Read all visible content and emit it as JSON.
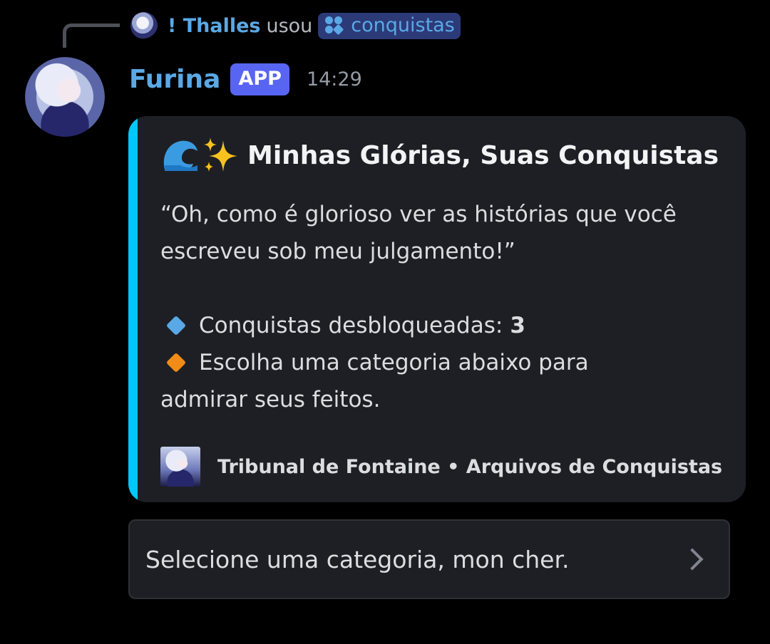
{
  "reply": {
    "user": "! Thalles",
    "action": "usou",
    "command": "conquistas",
    "user_color": "#5aa9e6"
  },
  "message": {
    "username": "Furina",
    "badge": "APP",
    "timestamp": "14:29"
  },
  "embed": {
    "accent_color": "#00c8ff",
    "title": "Minhas Glórias, Suas Conquistas",
    "title_icons": [
      "water-wave-icon",
      "sparkles-icon"
    ],
    "description_line1": "“Oh, como é glorioso ver as histórias que você",
    "description_line2": "escreveu sob meu julgamento!”",
    "item1_label": "Conquistas desbloqueadas:",
    "item1_value": "3",
    "item1_icon_color": "#5aa9e6",
    "item2_line1": "Escolha uma categoria abaixo para",
    "item2_line2": "admirar seus feitos.",
    "item2_icon_color": "#f28c16",
    "footer_text": "Tribunal de Fontaine • Arquivos de Conquistas"
  },
  "select": {
    "placeholder": "Selecione uma categoria, mon cher."
  }
}
